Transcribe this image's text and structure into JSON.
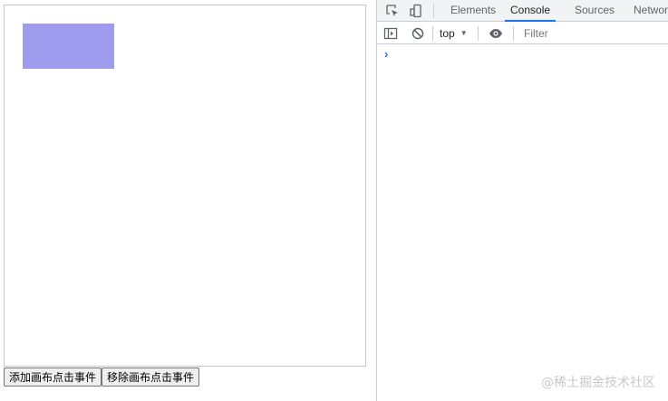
{
  "page": {
    "buttons": {
      "add_label": "添加画布点击事件",
      "remove_label": "移除画布点击事件"
    },
    "canvas": {
      "rect_fill_color": "#9e9bee"
    }
  },
  "devtools": {
    "tabs": [
      {
        "label": "Elements"
      },
      {
        "label": "Console"
      },
      {
        "label": "Sources"
      },
      {
        "label": "Network"
      }
    ],
    "active_tab": "Console",
    "active_tab_color": "#1a73e8",
    "toolbar": {
      "context": "top",
      "filter_placeholder": "Filter"
    },
    "console": {
      "prompt": "›"
    },
    "icons": [
      "inspect-element-icon",
      "device-toolbar-icon",
      "sidebar-toggle-icon",
      "clear-console-icon",
      "dropdown-arrow-icon",
      "eye-icon"
    ]
  },
  "watermark": "@稀土掘金技术社区"
}
